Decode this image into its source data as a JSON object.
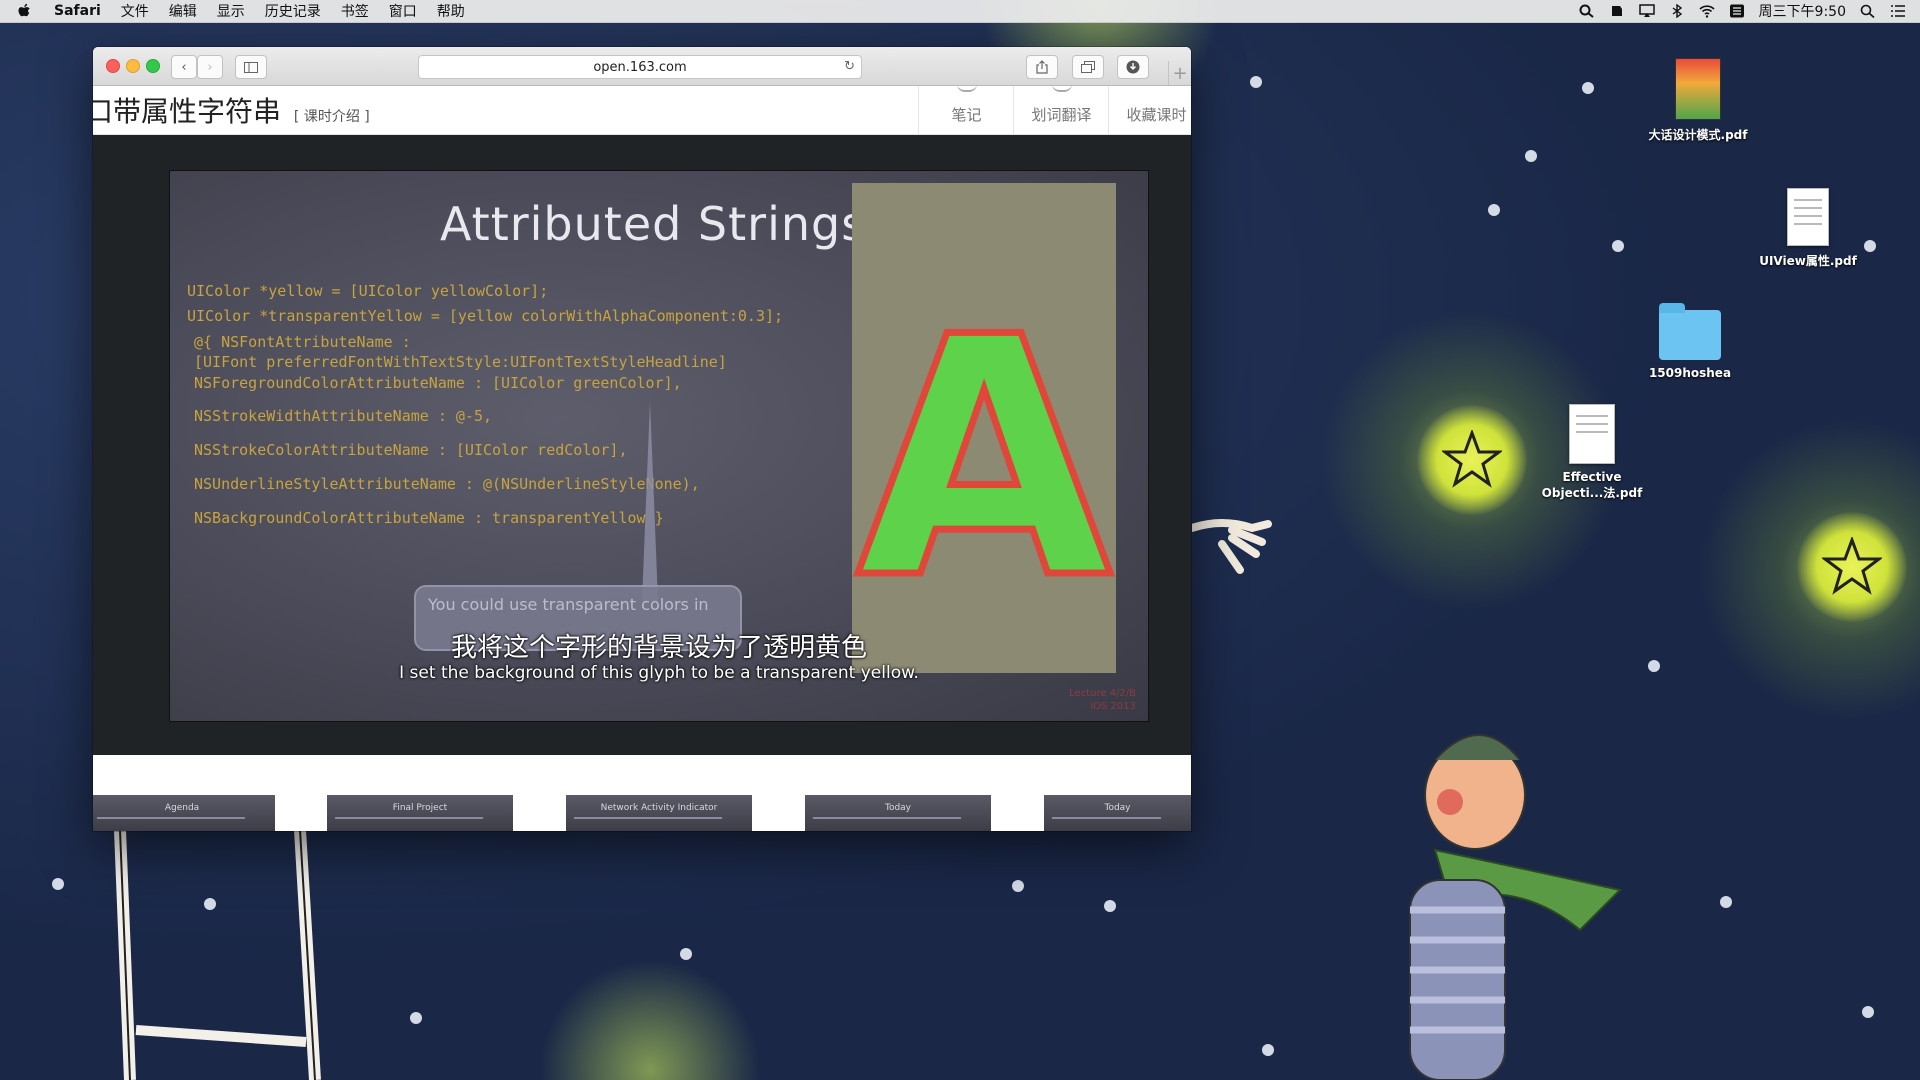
{
  "menubar": {
    "app": "Safari",
    "items": [
      "文件",
      "编辑",
      "显示",
      "历史记录",
      "书签",
      "窗口",
      "帮助"
    ],
    "clock": "周三下午9:50"
  },
  "desktop": {
    "icons": [
      {
        "label": "大话设计模式.pdf",
        "icon": "pdf-book-icon"
      },
      {
        "label": "UIView属性.pdf",
        "icon": "pdf-document-icon"
      },
      {
        "label": "1509hoshea",
        "icon": "folder-icon"
      },
      {
        "label_line1": "Effective",
        "label_line2": "Objecti...法.pdf",
        "icon": "pdf-document-icon"
      }
    ]
  },
  "browser": {
    "url": "open.163.com"
  },
  "page": {
    "title": "口带属性字符串",
    "intro_link": "[ 课时介绍 ]",
    "actions": [
      "笔记",
      "划词翻译",
      "收藏课时"
    ]
  },
  "video": {
    "slide_title": "Attributed Strings",
    "code_lines": [
      "UIColor *yellow = [UIColor yellowColor];",
      "UIColor *transparentYellow = [yellow colorWithAlphaComponent:0.3];",
      "@{ NSFontAttributeName :",
      "    [UIFont preferredFontWithTextStyle:UIFontTextStyleHeadline]",
      "   NSForegroundColorAttributeName : [UIColor greenColor],",
      "   NSStrokeWidthAttributeName : @-5,",
      "   NSStrokeColorAttributeName : [UIColor redColor],",
      "   NSUnderlineStyleAttributeName : @(NSUnderlineStyleNone),",
      "   NSBackgroundColorAttributeName : transparentYellow }"
    ],
    "glyph": "A",
    "bubble_text": "You could use transparent colors in",
    "subtitle_zh": "我将这个字形的背景设为了透明黄色",
    "subtitle_en": "I set the background of this glyph to be a transparent yellow.",
    "watermark_line1": "Lecture 4/2/B",
    "watermark_line2": "iOS 2013"
  },
  "thumbnails": [
    {
      "title": "Agenda"
    },
    {
      "title": "Final Project"
    },
    {
      "title": "Network Activity Indicator"
    },
    {
      "title": "Today"
    },
    {
      "title": "Today"
    }
  ],
  "colors": {
    "glyph_fill": "#5ed24a",
    "glyph_stroke": "#e0463a",
    "code": "#c7a43e"
  }
}
